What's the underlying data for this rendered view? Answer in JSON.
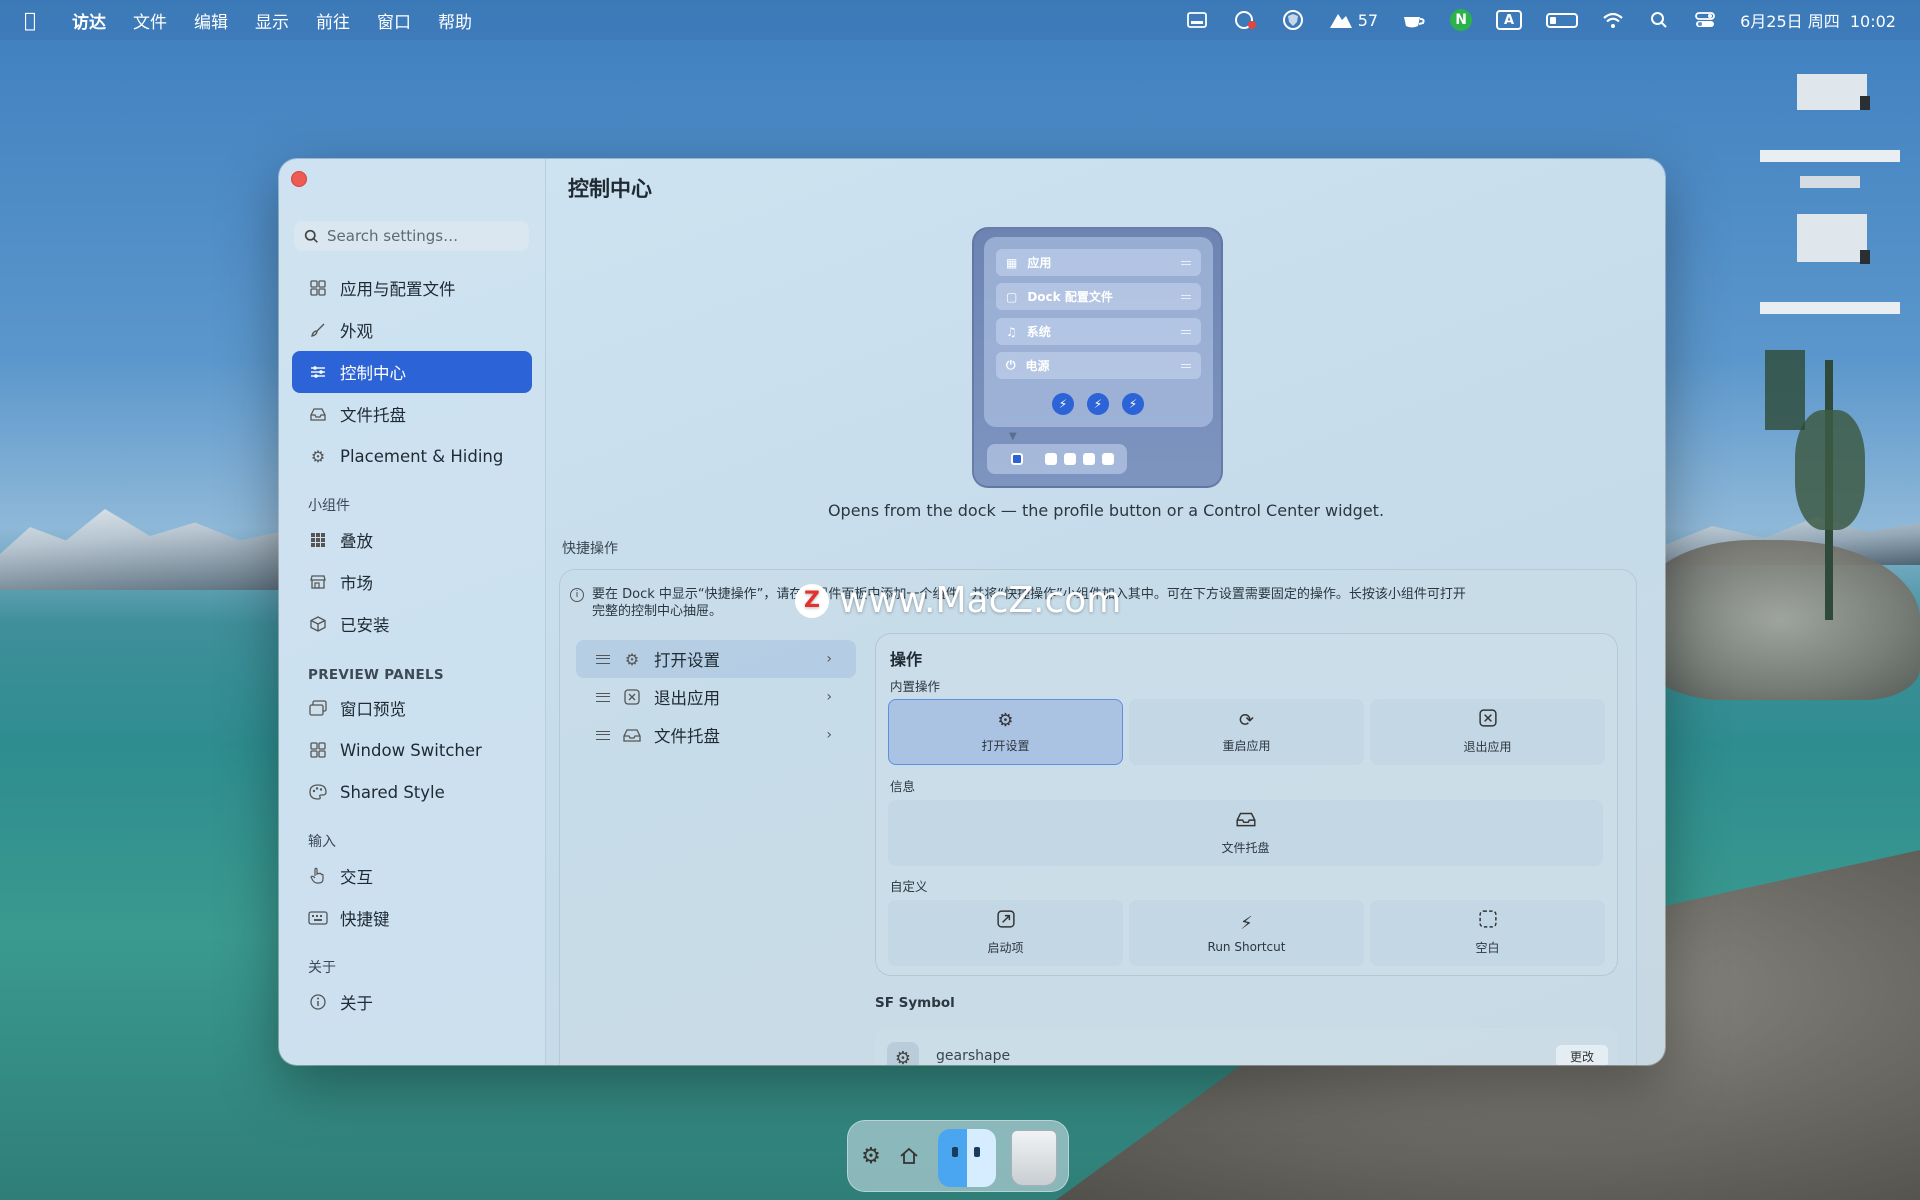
{
  "menubar": {
    "apple_icon": "apple-logo",
    "items": [
      "访达",
      "文件",
      "编辑",
      "显示",
      "前往",
      "窗口",
      "帮助"
    ],
    "status": {
      "weather_value": "57",
      "datetime": "6月25日 周四  10:02",
      "input_source": "A",
      "n_badge": "N"
    }
  },
  "window": {
    "title": "控制中心",
    "search": {
      "placeholder": "Search settings…",
      "value": ""
    },
    "sidebar": {
      "items": [
        {
          "label": "应用与配置文件",
          "icon": "grid-icon"
        },
        {
          "label": "外观",
          "icon": "paintbrush-icon"
        },
        {
          "label": "控制中心",
          "icon": "sliders-icon",
          "active": true
        },
        {
          "label": "文件托盘",
          "icon": "tray-icon"
        },
        {
          "label": "Placement & Hiding",
          "icon": "gear-icon"
        }
      ],
      "section_widgets": "小组件",
      "widget_items": [
        {
          "label": "叠放",
          "icon": "dots-grid-icon"
        },
        {
          "label": "市场",
          "icon": "store-icon"
        },
        {
          "label": "已安装",
          "icon": "box-icon"
        }
      ],
      "section_preview": "PREVIEW PANELS",
      "preview_items": [
        {
          "label": "窗口预览",
          "icon": "windows-icon"
        },
        {
          "label": "Window Switcher",
          "icon": "grid-icon"
        },
        {
          "label": "Shared Style",
          "icon": "palette-icon"
        }
      ],
      "section_input": "输入",
      "input_items": [
        {
          "label": "交互",
          "icon": "hand-pointer-icon"
        },
        {
          "label": "快捷键",
          "icon": "keyboard-icon"
        }
      ],
      "section_about": "关于",
      "about_items": [
        {
          "label": "关于",
          "icon": "info-icon"
        }
      ]
    },
    "preview": {
      "rows": [
        "应用",
        "Dock 配置文件",
        "系统",
        "电源"
      ],
      "caption": "Opens from the dock — the profile button or a Control Center widget."
    },
    "quick_actions": {
      "section_label": "快捷操作",
      "info_text": "要在 Dock 中显示“快捷操作”，请在小组件面板中添加一个组件，并将“快捷操作”小组件加入其中。可在下方设置需要固定的操作。长按该小组件可打开完整的控制中心抽屉。",
      "list": [
        {
          "label": "打开设置",
          "icon": "gear-icon",
          "selected": true
        },
        {
          "label": "退出应用",
          "icon": "xmark-square-icon",
          "selected": false
        },
        {
          "label": "文件托盘",
          "icon": "tray-icon",
          "selected": false
        }
      ],
      "ops": {
        "title": "操作",
        "builtin_label": "内置操作",
        "builtin": [
          {
            "label": "打开设置",
            "icon": "gear-icon",
            "selected": true
          },
          {
            "label": "重启应用",
            "icon": "restart-icon",
            "selected": false
          },
          {
            "label": "退出应用",
            "icon": "xmark-square-icon",
            "selected": false
          }
        ],
        "info_label": "信息",
        "info": [
          {
            "label": "文件托盘",
            "icon": "tray-icon"
          }
        ],
        "custom_label": "自定义",
        "custom": [
          {
            "label": "启动项",
            "icon": "arrow-square-icon"
          },
          {
            "label": "Run Shortcut",
            "icon": "bolt-icon"
          },
          {
            "label": "空白",
            "icon": "dashed-square-icon"
          }
        ]
      },
      "sf_symbol": {
        "label": "SF Symbol",
        "name": "gearshape",
        "change_button": "更改"
      }
    }
  },
  "watermark": {
    "z": "Z",
    "text": "www.MacZ.com"
  },
  "dock": {
    "items": [
      "settings-gear-icon",
      "home-icon",
      "finder-icon",
      "trash-icon"
    ]
  },
  "colors": {
    "accent": "#2c63d6",
    "close": "#ee5b55"
  }
}
